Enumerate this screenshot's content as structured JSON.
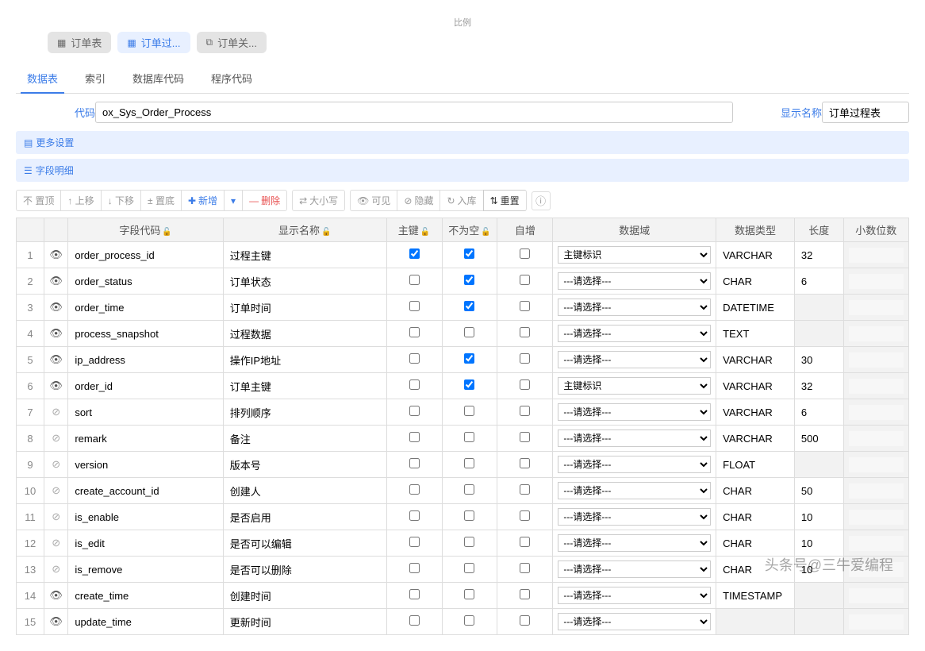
{
  "top_label": "比例",
  "topTabs": [
    {
      "icon": "table-icon",
      "label": "订单表",
      "active": false
    },
    {
      "icon": "table-icon",
      "label": "订单过...",
      "active": true
    },
    {
      "icon": "relation-icon",
      "label": "订单关...",
      "active": false
    }
  ],
  "subTabs": [
    {
      "label": "数据表",
      "active": true
    },
    {
      "label": "索引",
      "active": false
    },
    {
      "label": "数据库代码",
      "active": false
    },
    {
      "label": "程序代码",
      "active": false
    }
  ],
  "code": {
    "label": "代码",
    "value": "ox_Sys_Order_Process"
  },
  "displayName": {
    "label": "显示名称",
    "value": "订单过程表"
  },
  "sections": {
    "more": "更多设置",
    "fields": "字段明细"
  },
  "toolbar": {
    "top": "不 置顶",
    "up": "↑ 上移",
    "down": "↓ 下移",
    "bottom": "± 置底",
    "add": "新增",
    "del": "删除",
    "case": "大小写",
    "visible": "可见",
    "hide": "隐藏",
    "import": "入库",
    "reset": "重置"
  },
  "tableHeaders": {
    "fieldCode": "字段代码",
    "displayName": "显示名称",
    "pk": "主键",
    "notNull": "不为空",
    "autoInc": "自增",
    "domain": "数据域",
    "dataType": "数据类型",
    "length": "长度",
    "decimals": "小数位数"
  },
  "domainOptions": {
    "placeholder": "---请选择---",
    "pkId": "主键标识"
  },
  "rows": [
    {
      "idx": 1,
      "visible": true,
      "code": "order_process_id",
      "name": "过程主键",
      "pk": true,
      "nn": true,
      "ai": false,
      "domain": "主键标识",
      "dtype": "VARCHAR",
      "len": "32",
      "dec": ""
    },
    {
      "idx": 2,
      "visible": true,
      "code": "order_status",
      "name": "订单状态",
      "pk": false,
      "nn": true,
      "ai": false,
      "domain": "---请选择---",
      "dtype": "CHAR",
      "len": "6",
      "dec": ""
    },
    {
      "idx": 3,
      "visible": true,
      "code": "order_time",
      "name": "订单时间",
      "pk": false,
      "nn": true,
      "ai": false,
      "domain": "---请选择---",
      "dtype": "DATETIME",
      "len": "",
      "dec": ""
    },
    {
      "idx": 4,
      "visible": true,
      "code": "process_snapshot",
      "name": "过程数据",
      "pk": false,
      "nn": false,
      "ai": false,
      "domain": "---请选择---",
      "dtype": "TEXT",
      "len": "",
      "dec": ""
    },
    {
      "idx": 5,
      "visible": true,
      "code": "ip_address",
      "name": "操作IP地址",
      "pk": false,
      "nn": true,
      "ai": false,
      "domain": "---请选择---",
      "dtype": "VARCHAR",
      "len": "30",
      "dec": ""
    },
    {
      "idx": 6,
      "visible": true,
      "code": "order_id",
      "name": "订单主键",
      "pk": false,
      "nn": true,
      "ai": false,
      "domain": "主键标识",
      "dtype": "VARCHAR",
      "len": "32",
      "dec": ""
    },
    {
      "idx": 7,
      "visible": false,
      "code": "sort",
      "name": "排列顺序",
      "pk": false,
      "nn": false,
      "ai": false,
      "domain": "---请选择---",
      "dtype": "VARCHAR",
      "len": "6",
      "dec": ""
    },
    {
      "idx": 8,
      "visible": false,
      "code": "remark",
      "name": "备注",
      "pk": false,
      "nn": false,
      "ai": false,
      "domain": "---请选择---",
      "dtype": "VARCHAR",
      "len": "500",
      "dec": ""
    },
    {
      "idx": 9,
      "visible": false,
      "code": "version",
      "name": "版本号",
      "pk": false,
      "nn": false,
      "ai": false,
      "domain": "---请选择---",
      "dtype": "FLOAT",
      "len": "",
      "dec": ""
    },
    {
      "idx": 10,
      "visible": false,
      "code": "create_account_id",
      "name": "创建人",
      "pk": false,
      "nn": false,
      "ai": false,
      "domain": "---请选择---",
      "dtype": "CHAR",
      "len": "50",
      "dec": ""
    },
    {
      "idx": 11,
      "visible": false,
      "code": "is_enable",
      "name": "是否启用",
      "pk": false,
      "nn": false,
      "ai": false,
      "domain": "---请选择---",
      "dtype": "CHAR",
      "len": "10",
      "dec": ""
    },
    {
      "idx": 12,
      "visible": false,
      "code": "is_edit",
      "name": "是否可以编辑",
      "pk": false,
      "nn": false,
      "ai": false,
      "domain": "---请选择---",
      "dtype": "CHAR",
      "len": "10",
      "dec": ""
    },
    {
      "idx": 13,
      "visible": false,
      "code": "is_remove",
      "name": "是否可以删除",
      "pk": false,
      "nn": false,
      "ai": false,
      "domain": "---请选择---",
      "dtype": "CHAR",
      "len": "10",
      "dec": ""
    },
    {
      "idx": 14,
      "visible": true,
      "code": "create_time",
      "name": "创建时间",
      "pk": false,
      "nn": false,
      "ai": false,
      "domain": "---请选择---",
      "dtype": "TIMESTAMP",
      "len": "",
      "dec": ""
    },
    {
      "idx": 15,
      "visible": true,
      "code": "update_time",
      "name": "更新时间",
      "pk": false,
      "nn": false,
      "ai": false,
      "domain": "---请选择---",
      "dtype": "",
      "len": "",
      "dec": ""
    }
  ],
  "watermark": "头条号@三牛爱编程"
}
